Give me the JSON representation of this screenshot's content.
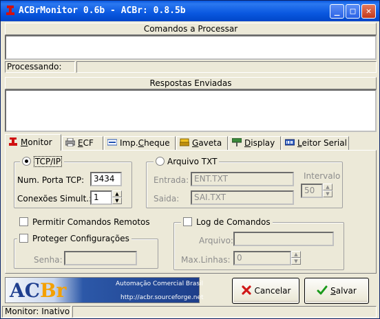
{
  "window": {
    "title": "ACBrMonitor 0.6b - ACBr: 0.8.5b",
    "controls": {
      "minimize": "_",
      "maximize": "□",
      "close": "✕"
    }
  },
  "commands": {
    "header": "Comandos a Processar",
    "content": ""
  },
  "processing": {
    "label": "Processando:",
    "value": ""
  },
  "responses": {
    "header": "Respostas Enviadas",
    "content": ""
  },
  "tabs": [
    {
      "label_pre": "",
      "label_u": "M",
      "label_post": "onitor",
      "icon": "acbr-icon",
      "active": true
    },
    {
      "label_pre": "",
      "label_u": "E",
      "label_post": "CF",
      "icon": "printer-icon",
      "active": false
    },
    {
      "label_pre": "Imp.",
      "label_u": "C",
      "label_post": "heque",
      "icon": "cheque-icon",
      "active": false
    },
    {
      "label_pre": "",
      "label_u": "G",
      "label_post": "aveta",
      "icon": "cash-drawer-icon",
      "active": false
    },
    {
      "label_pre": "",
      "label_u": "D",
      "label_post": "isplay",
      "icon": "display-icon",
      "active": false
    },
    {
      "label_pre": "",
      "label_u": "L",
      "label_post": "eitor Serial",
      "icon": "barcode-reader-icon",
      "active": false
    }
  ],
  "monitor": {
    "tcp": {
      "radio_label": "TCP/IP",
      "selected": true,
      "port_label": "Num. Porta TCP:",
      "port_value": "3434",
      "connections_label": "Conexões Simult.:",
      "connections_value": "1"
    },
    "txt": {
      "radio_label": "Arquivo TXT",
      "selected": false,
      "input_label": "Entrada:",
      "input_value": "ENT.TXT",
      "output_label": "Saida:",
      "output_value": "SAI.TXT",
      "interval_label": "Intervalo",
      "interval_value": "50"
    },
    "remote_commands_label": "Permitir Comandos Remotos",
    "protect_label": "Proteger Configurações",
    "password_label": "Senha:",
    "password_value": "",
    "log": {
      "label": "Log de Comandos",
      "file_label": "Arquivo:",
      "file_value": "",
      "max_lines_label": "Max.Linhas:",
      "max_lines_value": "0"
    }
  },
  "logo": {
    "text_a": "AC",
    "text_b": "Br",
    "caption": "Automação Comercial Brasil",
    "url": "http://acbr.sourceforge.net"
  },
  "buttons": {
    "cancel_label": "Cancelar",
    "save_pre": "",
    "save_u": "S",
    "save_post": "alvar"
  },
  "statusbar": {
    "text": "Monitor: Inativo",
    "extra": ""
  },
  "colors": {
    "titlebar": "#0a58e0",
    "face": "#ece9d8",
    "disabled_text": "#8c8c8c"
  }
}
